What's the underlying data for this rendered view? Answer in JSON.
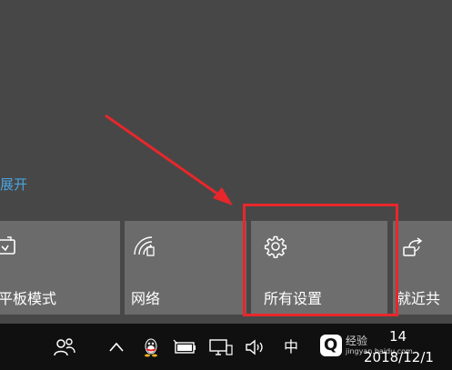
{
  "action_center": {
    "expand_label": "展开",
    "tiles": [
      {
        "id": "tablet",
        "label": "平板模式",
        "icon": "tablet-mode-icon"
      },
      {
        "id": "network",
        "label": "网络",
        "icon": "network-icon"
      },
      {
        "id": "settings",
        "label": "所有设置",
        "icon": "gear-icon"
      },
      {
        "id": "nearby",
        "label": "就近共",
        "icon": "nearby-sharing-icon"
      }
    ]
  },
  "annotation": {
    "color": "#e8272b"
  },
  "taskbar": {
    "ime_label": "中",
    "clock_time": "14",
    "clock_date": "2018/12/1",
    "tray_icons": [
      "people-icon",
      "chevron-up-icon",
      "qq-icon",
      "battery-icon",
      "network-tray-icon",
      "volume-icon"
    ]
  },
  "watermark": {
    "logo_letter": "Q",
    "text": "经验",
    "url": "jingyan.baidu.com"
  }
}
